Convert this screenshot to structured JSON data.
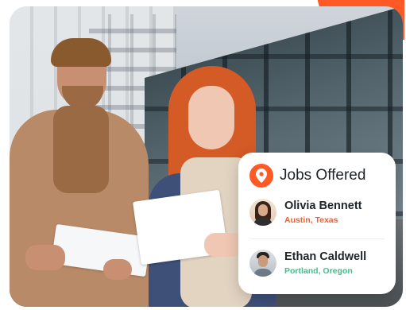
{
  "card": {
    "title": "Jobs Offered",
    "icon": "location-pin-icon",
    "accent_color": "#ff5a26"
  },
  "people": [
    {
      "name": "Olivia Bennett",
      "location": "Austin, Texas",
      "location_color": "#ff5a26"
    },
    {
      "name": "Ethan Caldwell",
      "location": "Portland, Oregon",
      "location_color": "#3cc28a"
    }
  ]
}
